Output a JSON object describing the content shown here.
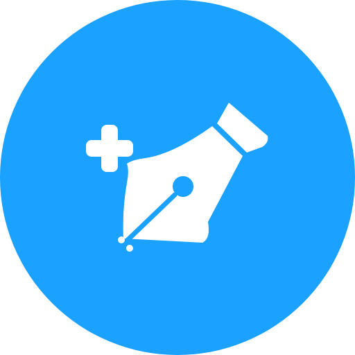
{
  "icon": {
    "name": "add-pen-tool-icon",
    "colors": {
      "background_circle": "#1ba1ff",
      "glyph": "#ffffff"
    },
    "parts": [
      "plus-icon",
      "pen-nib-icon"
    ]
  }
}
